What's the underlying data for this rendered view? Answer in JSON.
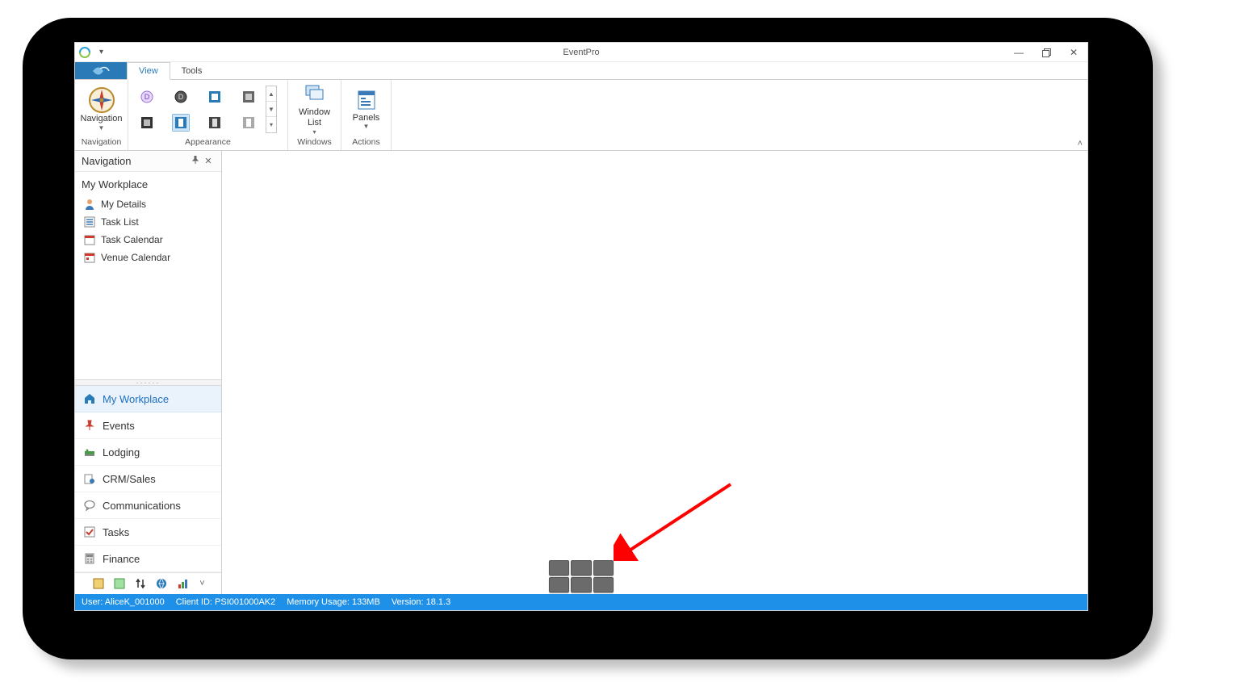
{
  "title": "EventPro",
  "tabs": {
    "file_icon": "swoosh",
    "view": "View",
    "tools": "Tools"
  },
  "ribbon": {
    "groups": {
      "navigation": {
        "label": "Navigation",
        "button": "Navigation"
      },
      "appearance": {
        "label": "Appearance"
      },
      "windows": {
        "label": "Windows",
        "window_list": "Window\nList"
      },
      "actions": {
        "label": "Actions",
        "panels": "Panels"
      }
    }
  },
  "nav_panel": {
    "title": "Navigation",
    "section_title": "My Workplace",
    "tree": [
      {
        "icon": "person",
        "label": "My Details"
      },
      {
        "icon": "tasklist",
        "label": "Task List"
      },
      {
        "icon": "cal-red",
        "label": "Task Calendar"
      },
      {
        "icon": "cal-blue",
        "label": "Venue Calendar"
      }
    ],
    "modules": [
      {
        "icon": "home",
        "label": "My Workplace",
        "active": true
      },
      {
        "icon": "pin",
        "label": "Events"
      },
      {
        "icon": "bed",
        "label": "Lodging"
      },
      {
        "icon": "crm",
        "label": "CRM/Sales"
      },
      {
        "icon": "chat",
        "label": "Communications"
      },
      {
        "icon": "check",
        "label": "Tasks"
      },
      {
        "icon": "calc",
        "label": "Finance"
      }
    ]
  },
  "statusbar": {
    "user": "User: AliceK_001000",
    "client": "Client ID: PSI001000AK2",
    "memory": "Memory Usage: 133MB",
    "version": "Version: 18.1.3"
  }
}
